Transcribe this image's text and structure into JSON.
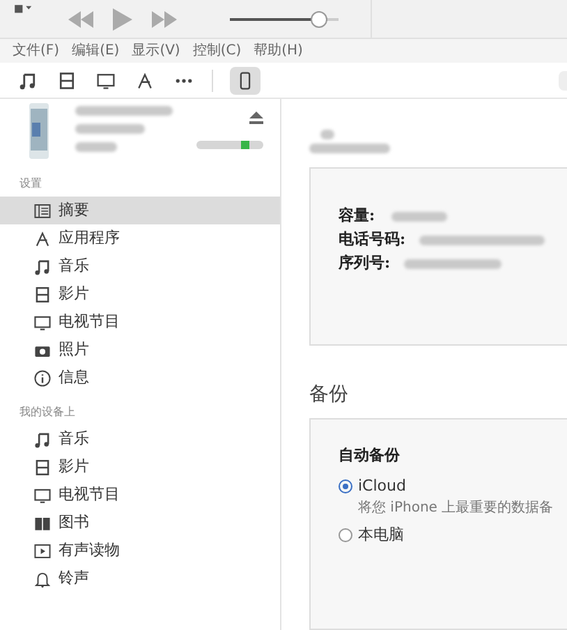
{
  "menu": [
    "文件(F)",
    "编辑(E)",
    "显示(V)",
    "控制(C)",
    "帮助(H)"
  ],
  "toolbar": [
    {
      "kind": "music",
      "selected": false
    },
    {
      "kind": "film",
      "selected": false
    },
    {
      "kind": "tv",
      "selected": false
    },
    {
      "kind": "apps",
      "selected": false
    },
    {
      "kind": "more",
      "selected": false
    },
    {
      "kind": "phone",
      "selected": true
    }
  ],
  "player": {
    "level": 0.9
  },
  "sidebar": {
    "sections": [
      {
        "title": "设置",
        "items": [
          {
            "label": "摘要",
            "kind": "summary",
            "selected": true
          },
          {
            "label": "应用程序",
            "kind": "apps",
            "selected": false
          },
          {
            "label": "音乐",
            "kind": "music",
            "selected": false
          },
          {
            "label": "影片",
            "kind": "film",
            "selected": false
          },
          {
            "label": "电视节目",
            "kind": "tv",
            "selected": false
          },
          {
            "label": "照片",
            "kind": "camera",
            "selected": false
          },
          {
            "label": "信息",
            "kind": "info",
            "selected": false
          }
        ]
      },
      {
        "title": "我的设备上",
        "items": [
          {
            "label": "音乐",
            "kind": "music",
            "selected": false
          },
          {
            "label": "影片",
            "kind": "film",
            "selected": false
          },
          {
            "label": "电视节目",
            "kind": "tv",
            "selected": false
          },
          {
            "label": "图书",
            "kind": "book",
            "selected": false
          },
          {
            "label": "有声读物",
            "kind": "audiobook",
            "selected": false
          },
          {
            "label": "铃声",
            "kind": "bell",
            "selected": false
          }
        ]
      }
    ]
  },
  "summary": {
    "fields": [
      "容量:",
      "电话号码:",
      "序列号:"
    ]
  },
  "backup": {
    "title": "备份",
    "heading": "自动备份",
    "options": [
      {
        "label": "iCloud",
        "selected": true,
        "description": "将您 iPhone 上最重要的数据备"
      },
      {
        "label": "本电脑",
        "selected": false
      }
    ]
  }
}
